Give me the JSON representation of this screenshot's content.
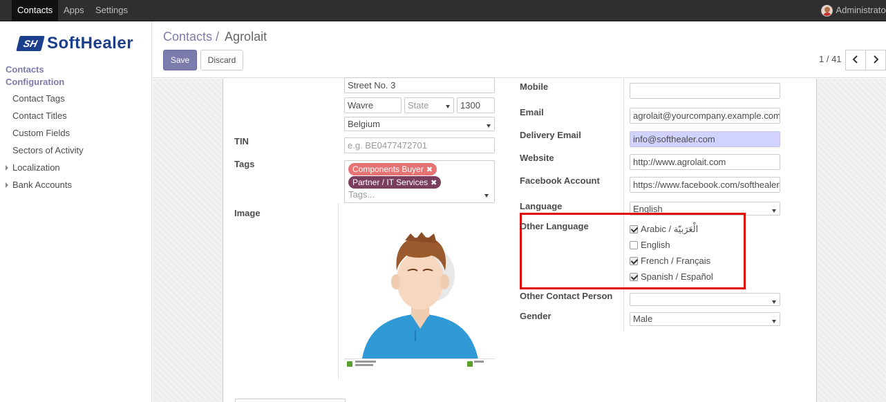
{
  "topbar": {
    "menus": [
      "Contacts",
      "Apps",
      "Settings"
    ],
    "user": "Administrator"
  },
  "sidebar": {
    "logo_mark": "SH",
    "logo_text": "SoftHealer",
    "sections": [
      "Contacts",
      "Configuration"
    ],
    "items": [
      "Contact Tags",
      "Contact Titles",
      "Custom Fields",
      "Sectors of Activity"
    ],
    "tree_items": [
      "Localization",
      "Bank Accounts"
    ]
  },
  "controlpanel": {
    "breadcrumb_parent": "Contacts /",
    "breadcrumb_current": "Agrolait",
    "save_label": "Save",
    "discard_label": "Discard",
    "pager": "1 / 41",
    "prev_icon": "chevron-left-icon",
    "next_icon": "chevron-right-icon"
  },
  "form": {
    "address": {
      "street": "Street No. 3",
      "city": "Wavre",
      "state_placeholder": "State",
      "zip": "1300",
      "country": "Belgium"
    },
    "tin_label": "TIN",
    "tin_placeholder": "e.g. BE0477472701",
    "tags_label": "Tags",
    "tags": [
      "Components Buyer",
      "Partner / IT Services"
    ],
    "tags_placeholder": "Tags...",
    "tag_remove_glyph": "✖",
    "image_label": "Image",
    "mobile_label": "Mobile",
    "mobile_value": "",
    "email_label": "Email",
    "email_value": "agrolait@yourcompany.example.com",
    "delivery_email_label": "Delivery Email",
    "delivery_email_value": "info@softhealer.com",
    "website_label": "Website",
    "website_value": "http://www.agrolait.com",
    "facebook_label": "Facebook Account",
    "facebook_value": "https://www.facebook.com/softhealer",
    "language_label": "Language",
    "language_value": "English",
    "other_language_label": "Other Language",
    "other_languages": [
      {
        "label": "Arabic / الْعَرَبيّة",
        "checked": true
      },
      {
        "label": "English",
        "checked": false
      },
      {
        "label": "French / Français",
        "checked": true
      },
      {
        "label": "Spanish / Español",
        "checked": true
      }
    ],
    "other_contact_label": "Other Contact Person",
    "other_contact_value": "",
    "gender_label": "Gender",
    "gender_value": "Male"
  },
  "colors": {
    "brand": "#7c7bad",
    "navbar": "#2f2f2f",
    "highlight_box": "#e00000",
    "delivery_email_bg": "#d2d2ff",
    "tag1": "#e57373",
    "tag2": "#7b3f5e"
  }
}
